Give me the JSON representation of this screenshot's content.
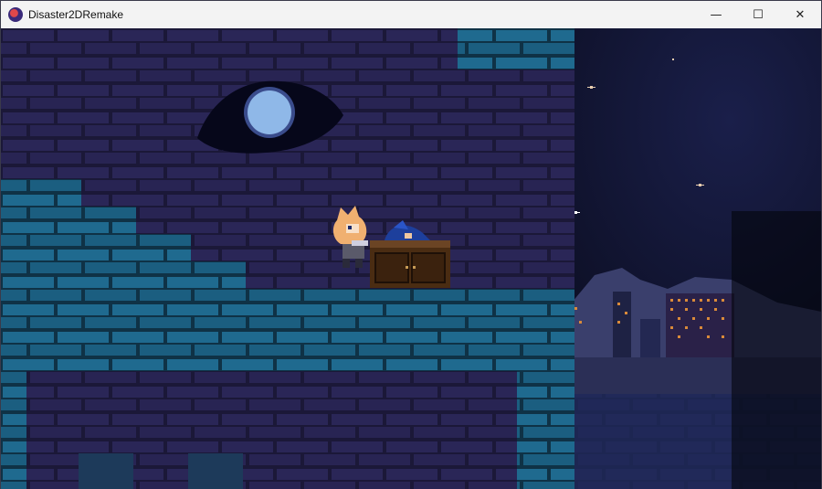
{
  "window": {
    "title": "Disaster2DRemake",
    "icon": "sonic-icon",
    "controls": {
      "minimize": "—",
      "maximize": "☐",
      "close": "✕"
    }
  },
  "scene": {
    "colors": {
      "sky": "#0d1033",
      "brick_dark": "#262250",
      "brick_teal": "#1d5f86",
      "moon": "#8fb8e8",
      "crate": "#4a2c12"
    }
  }
}
